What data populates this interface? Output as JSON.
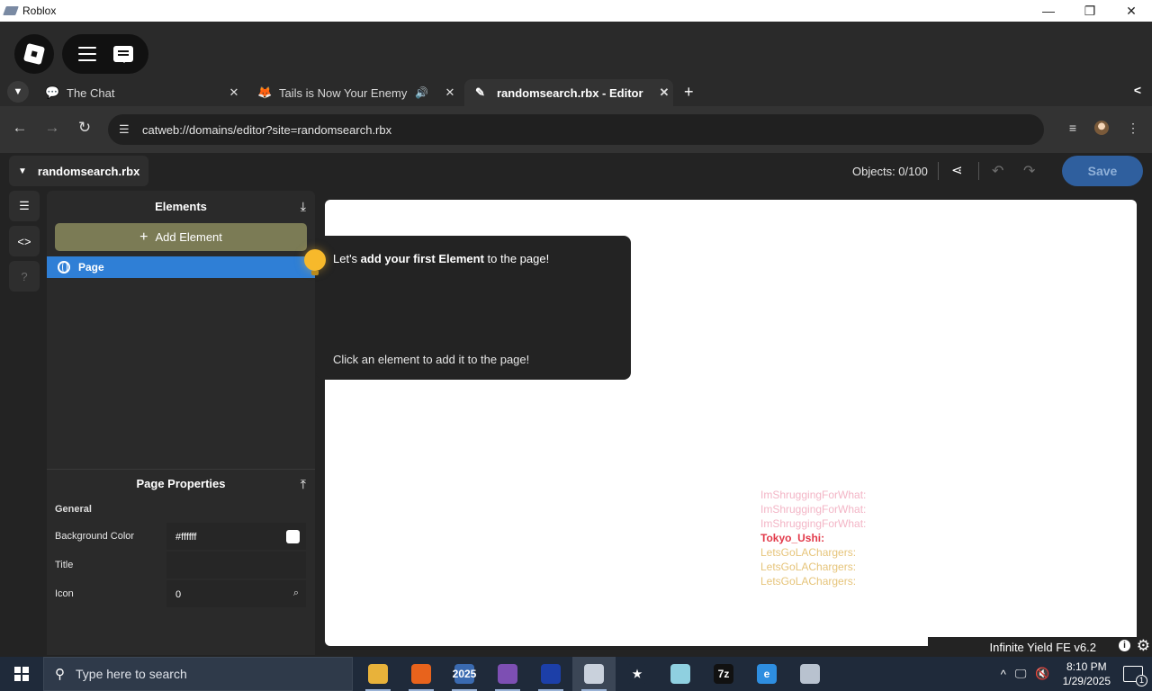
{
  "window": {
    "title": "Roblox",
    "controls": {
      "minimize": "—",
      "restore": "❐",
      "close": "✕"
    }
  },
  "tabs": [
    {
      "label": "The Chat",
      "icon": "chat-bubble-icon",
      "close": "✕"
    },
    {
      "label": "Tails is Now Your Enemy",
      "icon": "tails-icon",
      "audio": "🔊",
      "close": "✕"
    },
    {
      "label": "randomsearch.rbx - Editor",
      "icon": "pencil-icon",
      "close": "✕",
      "active": true
    }
  ],
  "tab_new": "+",
  "tab_side": "<",
  "address": {
    "url": "catweb://domains/editor?site=randomsearch.rbx",
    "back": "←",
    "forward": "→",
    "reload": "↻"
  },
  "editor": {
    "site_name": "randomsearch.rbx",
    "objects": "Objects: 0/100",
    "save_label": "Save"
  },
  "rail": {
    "help": "?"
  },
  "elements_panel": {
    "title": "Elements",
    "add_label": "Add Element",
    "tree": [
      {
        "label": "Page",
        "selected": true
      }
    ]
  },
  "page_properties": {
    "title": "Page Properties",
    "section": "General",
    "rows": [
      {
        "label": "Background Color",
        "value": "#ffffff"
      },
      {
        "label": "Title",
        "value": ""
      },
      {
        "label": "Icon",
        "value": "0"
      }
    ]
  },
  "tooltip": {
    "line1_pre": "Let's ",
    "line1_bold": "add your first Element",
    "line1_post": " to the page!",
    "line2": "Click an element to add it to the page!"
  },
  "chat_log": [
    {
      "text": "ImShruggingForWhat:",
      "color": "#f3b5c6"
    },
    {
      "text": "ImShruggingForWhat:",
      "color": "#f3b5c6"
    },
    {
      "text": "ImShruggingForWhat:",
      "color": "#f3b5c6"
    },
    {
      "text": "Tokyo_Ushi:",
      "color": "#e23a4a"
    },
    {
      "text": "LetsGoLAChargers:",
      "color": "#e6c47a"
    },
    {
      "text": "LetsGoLAChargers:",
      "color": "#e6c47a"
    },
    {
      "text": "LetsGoLAChargers:",
      "color": "#e6c47a"
    }
  ],
  "infinite_yield": {
    "label": "Infinite Yield FE v6.2",
    "info": "i",
    "gear": "⚙"
  },
  "taskbar": {
    "search_placeholder": "Type here to search",
    "apps": [
      {
        "name": "file-explorer",
        "glyph": "",
        "color": "#e8b23a"
      },
      {
        "name": "firefox",
        "glyph": "",
        "color": "#e8631c"
      },
      {
        "name": "game-2025",
        "glyph": "2025",
        "color": "#3a6ab0"
      },
      {
        "name": "tor-browser",
        "glyph": "",
        "color": "#7d4fb3"
      },
      {
        "name": "app-blue",
        "glyph": "",
        "color": "#1c3fa8"
      },
      {
        "name": "roblox",
        "glyph": "",
        "color": "#c9d1dc"
      },
      {
        "name": "star-app",
        "glyph": "★",
        "color": "#1f2a3a"
      },
      {
        "name": "app-diamond",
        "glyph": "",
        "color": "#8fd0e0"
      },
      {
        "name": "7zip",
        "glyph": "7z",
        "color": "#111111"
      },
      {
        "name": "edge-legacy",
        "glyph": "e",
        "color": "#2e8ee0"
      },
      {
        "name": "app-drive",
        "glyph": "",
        "color": "#b8c2cf"
      }
    ],
    "time": "8:10 PM",
    "date": "1/29/2025",
    "notifications": "1"
  }
}
